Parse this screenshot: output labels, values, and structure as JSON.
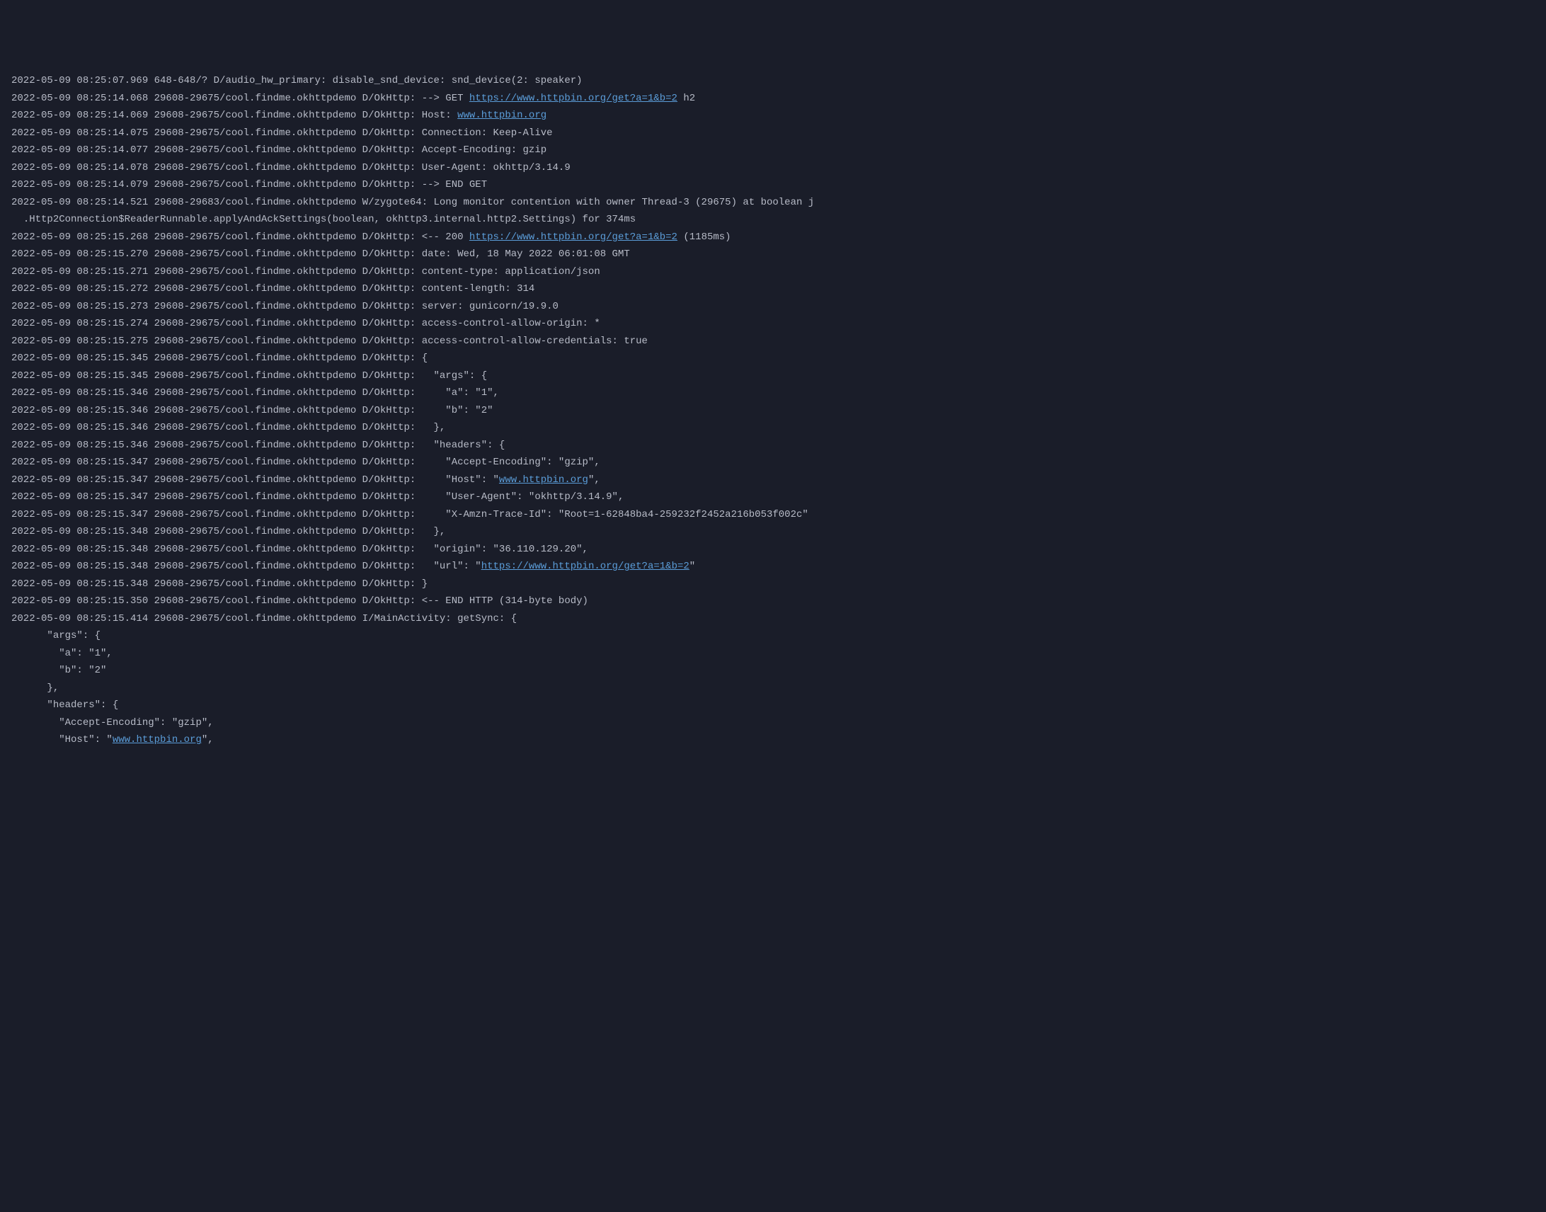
{
  "logs": [
    {
      "pre": "2022-05-09 08:25:07.969 648-648/? D/audio_hw_primary: disable_snd_device: snd_device(2: speaker)",
      "link": null,
      "post": null
    },
    {
      "pre": "2022-05-09 08:25:14.068 29608-29675/cool.findme.okhttpdemo D/OkHttp: --> GET ",
      "link": "https://www.httpbin.org/get?a=1&b=2",
      "post": " h2"
    },
    {
      "pre": "2022-05-09 08:25:14.069 29608-29675/cool.findme.okhttpdemo D/OkHttp: Host: ",
      "link": "www.httpbin.org",
      "post": null
    },
    {
      "pre": "2022-05-09 08:25:14.075 29608-29675/cool.findme.okhttpdemo D/OkHttp: Connection: Keep-Alive",
      "link": null,
      "post": null
    },
    {
      "pre": "2022-05-09 08:25:14.077 29608-29675/cool.findme.okhttpdemo D/OkHttp: Accept-Encoding: gzip",
      "link": null,
      "post": null
    },
    {
      "pre": "2022-05-09 08:25:14.078 29608-29675/cool.findme.okhttpdemo D/OkHttp: User-Agent: okhttp/3.14.9",
      "link": null,
      "post": null
    },
    {
      "pre": "2022-05-09 08:25:14.079 29608-29675/cool.findme.okhttpdemo D/OkHttp: --> END GET",
      "link": null,
      "post": null
    },
    {
      "pre": "2022-05-09 08:25:14.521 29608-29683/cool.findme.okhttpdemo W/zygote64: Long monitor contention with owner Thread-3 (29675) at boolean j",
      "link": null,
      "post": null
    },
    {
      "pre": "  .Http2Connection$ReaderRunnable.applyAndAckSettings(boolean, okhttp3.internal.http2.Settings) for 374ms",
      "link": null,
      "post": null
    },
    {
      "pre": "2022-05-09 08:25:15.268 29608-29675/cool.findme.okhttpdemo D/OkHttp: <-- 200 ",
      "link": "https://www.httpbin.org/get?a=1&b=2",
      "post": " (1185ms)"
    },
    {
      "pre": "2022-05-09 08:25:15.270 29608-29675/cool.findme.okhttpdemo D/OkHttp: date: Wed, 18 May 2022 06:01:08 GMT",
      "link": null,
      "post": null
    },
    {
      "pre": "2022-05-09 08:25:15.271 29608-29675/cool.findme.okhttpdemo D/OkHttp: content-type: application/json",
      "link": null,
      "post": null
    },
    {
      "pre": "2022-05-09 08:25:15.272 29608-29675/cool.findme.okhttpdemo D/OkHttp: content-length: 314",
      "link": null,
      "post": null
    },
    {
      "pre": "2022-05-09 08:25:15.273 29608-29675/cool.findme.okhttpdemo D/OkHttp: server: gunicorn/19.9.0",
      "link": null,
      "post": null
    },
    {
      "pre": "2022-05-09 08:25:15.274 29608-29675/cool.findme.okhttpdemo D/OkHttp: access-control-allow-origin: *",
      "link": null,
      "post": null
    },
    {
      "pre": "2022-05-09 08:25:15.275 29608-29675/cool.findme.okhttpdemo D/OkHttp: access-control-allow-credentials: true",
      "link": null,
      "post": null
    },
    {
      "pre": "2022-05-09 08:25:15.345 29608-29675/cool.findme.okhttpdemo D/OkHttp: {",
      "link": null,
      "post": null
    },
    {
      "pre": "2022-05-09 08:25:15.345 29608-29675/cool.findme.okhttpdemo D/OkHttp:   \"args\": {",
      "link": null,
      "post": null
    },
    {
      "pre": "2022-05-09 08:25:15.346 29608-29675/cool.findme.okhttpdemo D/OkHttp:     \"a\": \"1\", ",
      "link": null,
      "post": null
    },
    {
      "pre": "2022-05-09 08:25:15.346 29608-29675/cool.findme.okhttpdemo D/OkHttp:     \"b\": \"2\"",
      "link": null,
      "post": null
    },
    {
      "pre": "2022-05-09 08:25:15.346 29608-29675/cool.findme.okhttpdemo D/OkHttp:   }, ",
      "link": null,
      "post": null
    },
    {
      "pre": "2022-05-09 08:25:15.346 29608-29675/cool.findme.okhttpdemo D/OkHttp:   \"headers\": {",
      "link": null,
      "post": null
    },
    {
      "pre": "2022-05-09 08:25:15.347 29608-29675/cool.findme.okhttpdemo D/OkHttp:     \"Accept-Encoding\": \"gzip\", ",
      "link": null,
      "post": null
    },
    {
      "pre": "2022-05-09 08:25:15.347 29608-29675/cool.findme.okhttpdemo D/OkHttp:     \"Host\": \"",
      "link": "www.httpbin.org",
      "post": "\", "
    },
    {
      "pre": "2022-05-09 08:25:15.347 29608-29675/cool.findme.okhttpdemo D/OkHttp:     \"User-Agent\": \"okhttp/3.14.9\", ",
      "link": null,
      "post": null
    },
    {
      "pre": "2022-05-09 08:25:15.347 29608-29675/cool.findme.okhttpdemo D/OkHttp:     \"X-Amzn-Trace-Id\": \"Root=1-62848ba4-259232f2452a216b053f002c\"",
      "link": null,
      "post": null
    },
    {
      "pre": "2022-05-09 08:25:15.348 29608-29675/cool.findme.okhttpdemo D/OkHttp:   }, ",
      "link": null,
      "post": null
    },
    {
      "pre": "2022-05-09 08:25:15.348 29608-29675/cool.findme.okhttpdemo D/OkHttp:   \"origin\": \"36.110.129.20\", ",
      "link": null,
      "post": null
    },
    {
      "pre": "2022-05-09 08:25:15.348 29608-29675/cool.findme.okhttpdemo D/OkHttp:   \"url\": \"",
      "link": "https://www.httpbin.org/get?a=1&b=2",
      "post": "\""
    },
    {
      "pre": "2022-05-09 08:25:15.348 29608-29675/cool.findme.okhttpdemo D/OkHttp: }",
      "link": null,
      "post": null
    },
    {
      "pre": "2022-05-09 08:25:15.350 29608-29675/cool.findme.okhttpdemo D/OkHttp: <-- END HTTP (314-byte body)",
      "link": null,
      "post": null
    },
    {
      "pre": "2022-05-09 08:25:15.414 29608-29675/cool.findme.okhttpdemo I/MainActivity: getSync: {",
      "link": null,
      "post": null
    },
    {
      "pre": "      \"args\": {",
      "link": null,
      "post": null
    },
    {
      "pre": "        \"a\": \"1\", ",
      "link": null,
      "post": null
    },
    {
      "pre": "        \"b\": \"2\"",
      "link": null,
      "post": null
    },
    {
      "pre": "      }, ",
      "link": null,
      "post": null
    },
    {
      "pre": "      \"headers\": {",
      "link": null,
      "post": null
    },
    {
      "pre": "        \"Accept-Encoding\": \"gzip\", ",
      "link": null,
      "post": null
    },
    {
      "pre": "        \"Host\": \"",
      "link": "www.httpbin.org",
      "post": "\", "
    }
  ]
}
